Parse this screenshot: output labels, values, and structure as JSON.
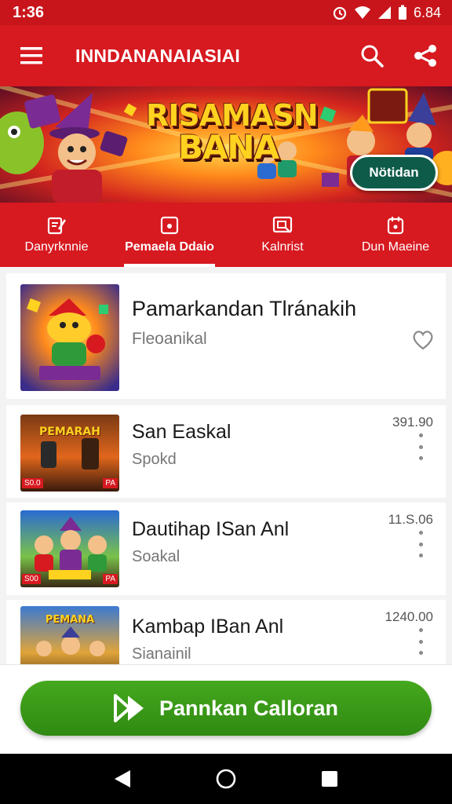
{
  "status_bar": {
    "time": "1:36",
    "battery": "6.84"
  },
  "app_bar": {
    "title": "INNDANANAIASIAI",
    "menu_icon": "hamburger-menu-icon",
    "search_icon": "search-icon",
    "share_icon": "share-icon"
  },
  "banner": {
    "title_line1": "RISAMASN",
    "title_line2": "BANA",
    "cta_label": "Nötidan"
  },
  "tabs": [
    {
      "label": "Danyrknnie",
      "icon": "edit-doc-icon"
    },
    {
      "label": "Pemaela Ddaio",
      "icon": "media-card-icon"
    },
    {
      "label": "Kalnrist",
      "icon": "image-frame-icon"
    },
    {
      "label": "Dun Maeine",
      "icon": "calendar-icon"
    }
  ],
  "featured": {
    "title": "Pamarkandan Tlránakih",
    "subtitle": "Fleoanikal"
  },
  "items": [
    {
      "title": "San Easkal",
      "subtitle": "Spokd",
      "meta": "391.90",
      "thumb_text": "PEMARAH",
      "tag_left": "S0.0",
      "tag_right": "PA"
    },
    {
      "title": "Dautihap ISan Anl",
      "subtitle": "Soakal",
      "meta": "11.S.06",
      "thumb_text": "",
      "tag_left": "S00",
      "tag_right": "PA"
    },
    {
      "title": "Kambap IBan Anl",
      "subtitle": "Sianainil",
      "meta": "1240.00",
      "thumb_text": "PEMANA",
      "tag_left": "",
      "tag_right": ""
    }
  ],
  "cta": {
    "label": "Pannkan Calloran",
    "icon": "fast-forward-icon"
  },
  "colors": {
    "primary": "#d71920",
    "status_bar": "#c8151b",
    "cta_green": "#3a9a18",
    "banner_cta": "#0e5b4a"
  }
}
